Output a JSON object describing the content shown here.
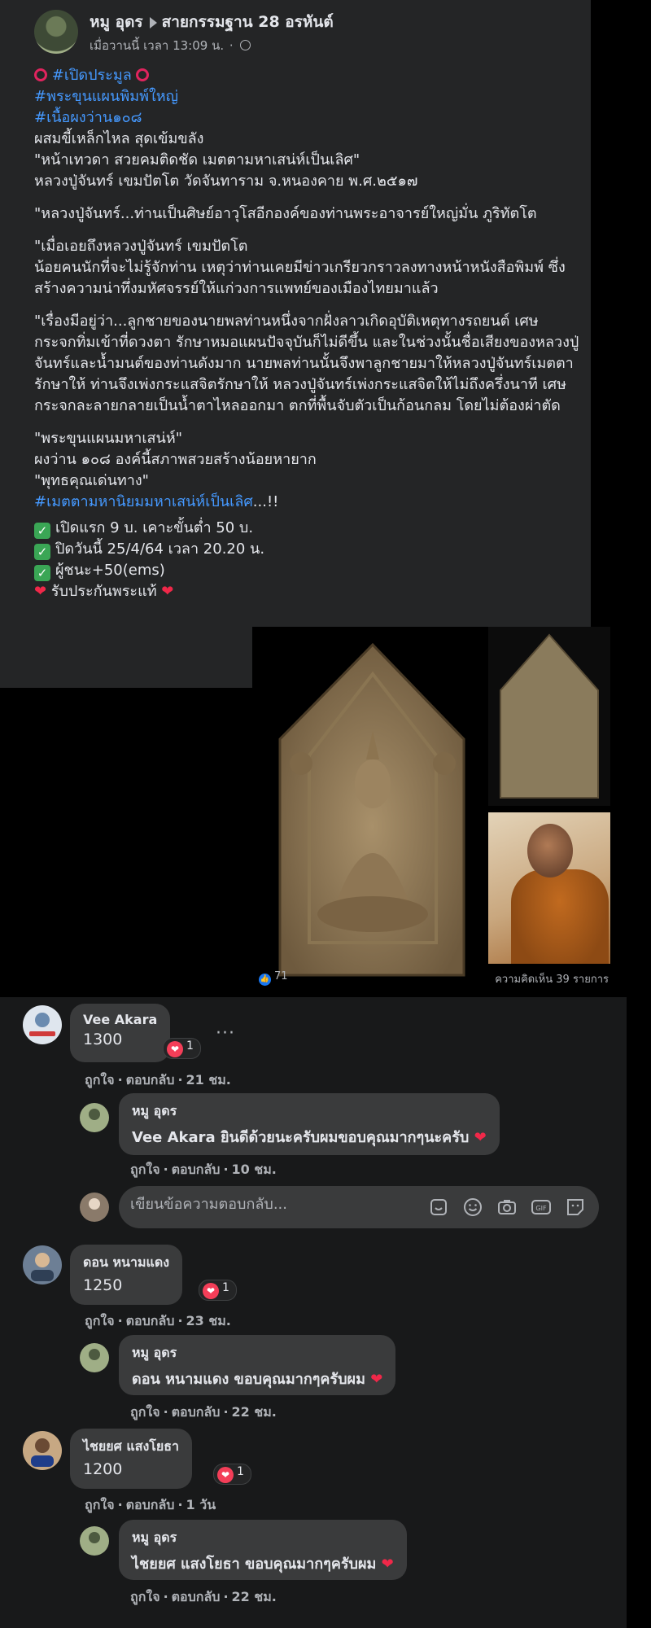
{
  "post": {
    "author": "หมู อุดร",
    "group": "สายกรรมฐาน 28 อรหันต์",
    "timestamp": "เมื่อวานนี้ เวลา 13:09 น.",
    "lines": [
      "#เปิดประมูล",
      "#พระขุนแผนพิมพ์ใหญ่",
      "#เนื้อผงว่าน๑๐๘",
      "ผสมขี้เหล็กไหล สุดเข้มขลัง",
      "\"หน้าเทวดา สวยคมติดชัด เมตตามหาเสน่ห์เป็นเลิศ\"",
      "หลวงปู่จันทร์ เขมปัตโต  วัดจันทาราม  จ.หนองคาย พ.ศ.๒๕๑๗",
      "\"หลวงปู่จันทร์...ท่านเป็นศิษย์อาวุโสอีกองค์ของท่านพระอาจารย์ใหญ่มั่น ภูริทัตโต",
      "\"เมื่อเอยถึงหลวงปู่จันทร์ เขมปัตโต",
      "น้อยคนนักที่จะไม่รู้จักท่าน เหตุว่าท่านเคยมีข่าวเกรียวกราวลงทางหน้าหนังสือพิมพ์ ซึ่งสร้างความน่าทึ่งมหัศจรรย์ให้แก่วงการแพทย์ของเมืองไทยมาแล้ว",
      "\"เรื่องมีอยู่ว่า...ลูกชายของนายพลท่านหนึ่งจากฝั่งลาวเกิดอุบัติเหตุทางรถยนต์ เศษกระจกทิ่มเข้าที่ดวงตา รักษาหมอแผนปัจจุบันก็ไม่ดีขึ้น และในช่วงนั้นชื่อเสียงของหลวงปู่จันทร์และน้ำมนต์ของท่านดังมาก นายพลท่านนั้นจึงพาลูกชายมาให้หลวงปู่จันทร์เมตตารักษาให้ ท่านจึงเพ่งกระแสจิตรักษาให้ หลวงปู่จันทร์เพ่งกระแสจิตให้ไม่ถึงครึ่งนาที เศษกระจกละลายกลายเป็นน้ำตาไหลออกมา ตกที่พื้นจับตัวเป็นก้อนกลม โดยไม่ต้องผ่าตัด",
      "\"พระขุนแผนมหาเสน่ห์\"",
      "ผงว่าน ๑๐๘ องค์นี้สภาพสวยสร้างน้อยหายาก",
      "\"พุทธคุณเด่นทาง\"",
      "#เมตตามหานิยมมหาเสน่ห์เป็นเลิศ",
      "...!!",
      "เปิดแรก 9 บ. เคาะขั้นต่ำ 50 บ.",
      "ปิดวันนี้ 25/4/64 เวลา 20.20 น.",
      "ผู้ชนะ+50(ems)",
      "รับประกันพระแท้"
    ],
    "likes": "71",
    "comments_count": "ความคิดเห็น 39 รายการ"
  },
  "icons": {
    "globe": "globe-icon",
    "check": "check-icon",
    "heart": "heart-icon",
    "like": "like-icon"
  },
  "comments": [
    {
      "name": "Vee Akara",
      "text": "1300",
      "reactions": "1",
      "like": "ถูกใจ",
      "reply": "ตอบกลับ",
      "time": "21 ชม.",
      "reply_name": "หมู อุดร",
      "reply_text": "Vee Akara ยินดีด้วยนะครับผมขอบคุณมากๆนะครับ",
      "reply_time": "10 ชม."
    },
    {
      "name": "ดอน หนามแดง",
      "text": "1250",
      "reactions": "1",
      "like": "ถูกใจ",
      "reply": "ตอบกลับ",
      "time": "23 ชม.",
      "reply_name": "หมู อุดร",
      "reply_text": "ดอน หนามแดง ขอบคุณมากๆครับผม",
      "reply_time": "22 ชม."
    },
    {
      "name": "ไชยยศ แสงโยธา",
      "text": "1200",
      "reactions": "1",
      "like": "ถูกใจ",
      "reply": "ตอบกลับ",
      "time": "1 วัน",
      "reply_name": "หมู อุดร",
      "reply_text": "ไชยยศ แสงโยธา ขอบคุณมากๆครับผม",
      "reply_time": "22 ชม."
    }
  ],
  "reply_box": {
    "placeholder": "เขียนข้อความตอบกลับ..."
  },
  "colors": {
    "hashtag": "#4599ff",
    "card": "#242526",
    "bubble": "#3a3b3c",
    "heart": "#f33e58"
  }
}
